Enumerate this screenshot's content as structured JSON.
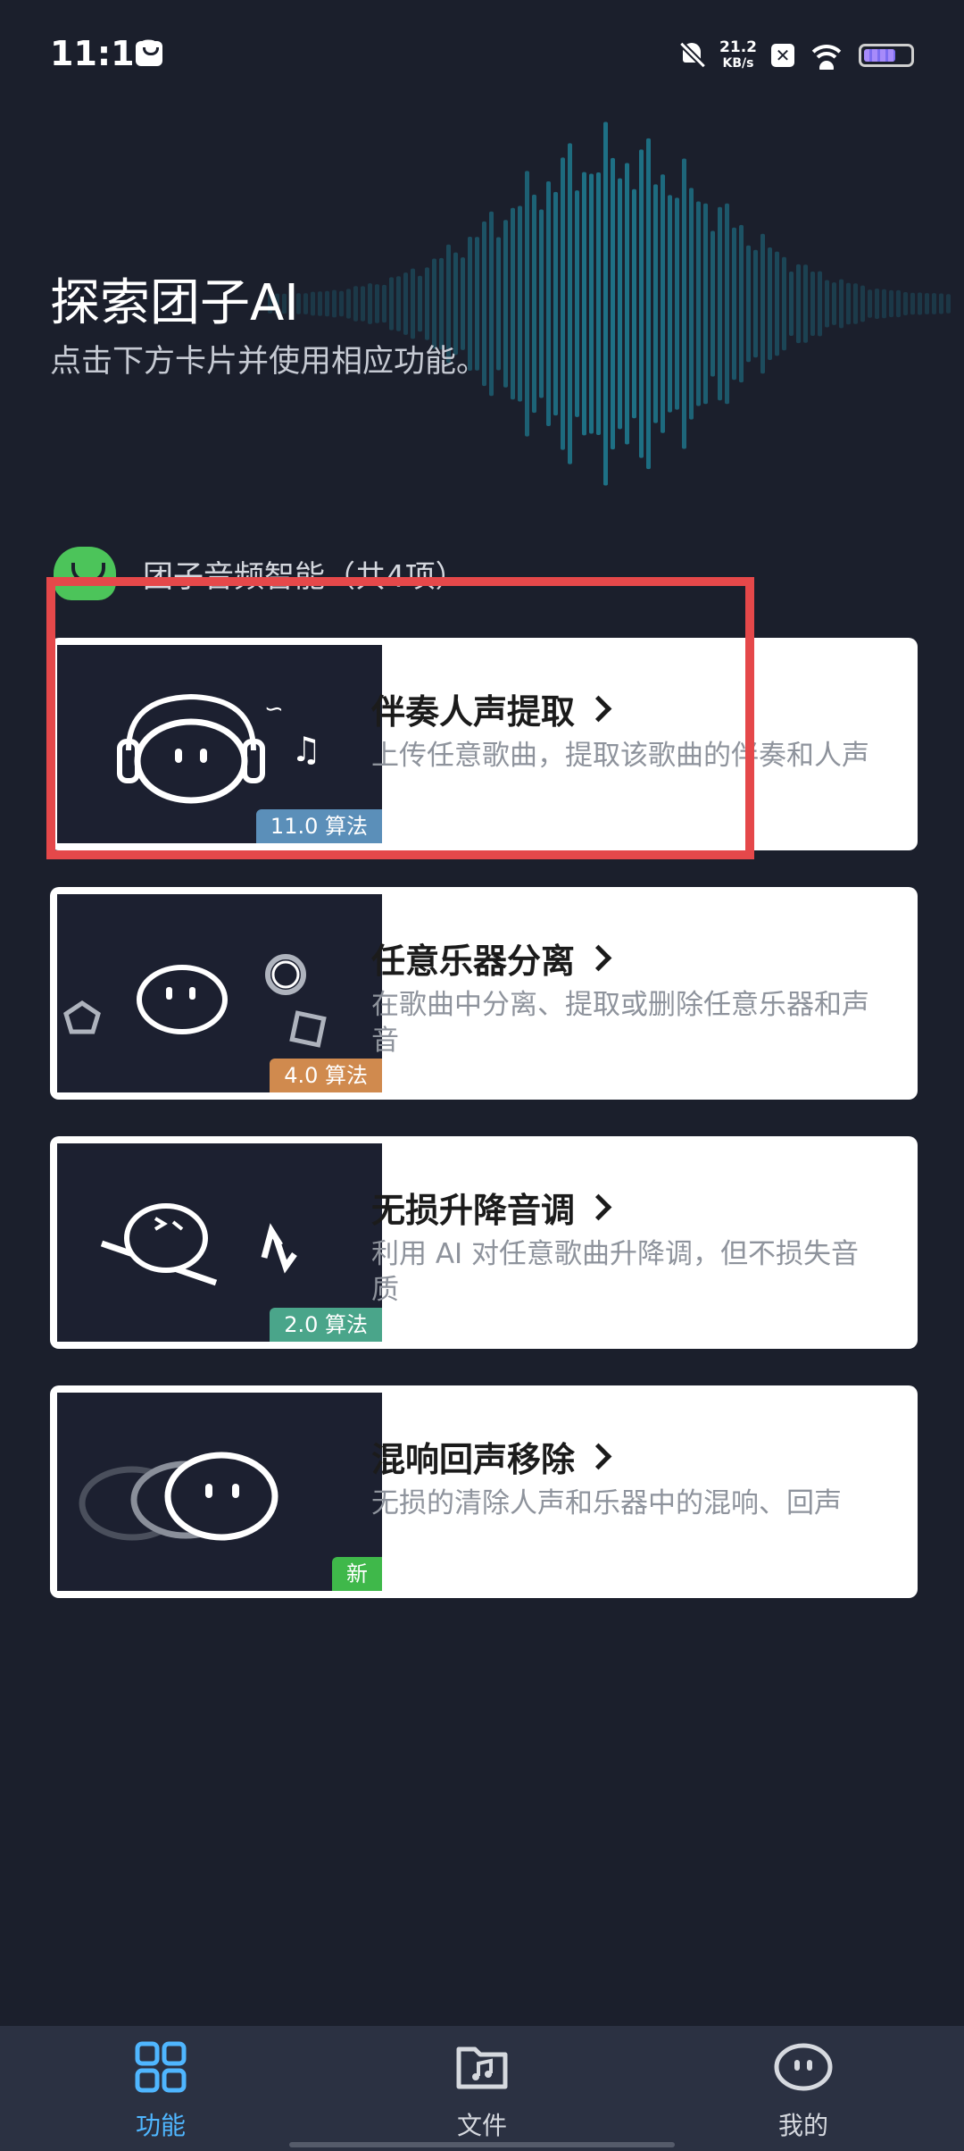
{
  "status_bar": {
    "time": "11:16",
    "net_speed_value": "21.2",
    "net_speed_unit": "KB/s",
    "battery_level": 0.7
  },
  "hero": {
    "title": "探索团子AI",
    "subtitle": "点击下方卡片并使用相应功能。"
  },
  "section": {
    "title": "团子音频智能（共4项）"
  },
  "cards": [
    {
      "title": "伴奏人声提取",
      "description": "上传任意歌曲，提取该歌曲的伴奏和人声",
      "badge": "11.0 算法",
      "badge_color": "#5b8fb9"
    },
    {
      "title": "任意乐器分离",
      "description": "在歌曲中分离、提取或删除任意乐器和声音",
      "badge": "4.0 算法",
      "badge_color": "#d08a4e"
    },
    {
      "title": "无损升降音调",
      "description": "利用 AI 对任意歌曲升降调，但不损失音质",
      "badge": "2.0 算法",
      "badge_color": "#4aa58a"
    },
    {
      "title": "混响回声移除",
      "description": "无损的清除人声和乐器中的混响、回声",
      "badge": "新",
      "badge_color": "#3fb84a"
    }
  ],
  "bottom_nav": {
    "tabs": [
      {
        "label": "功能",
        "icon": "grid-icon",
        "active": true
      },
      {
        "label": "文件",
        "icon": "music-folder-icon",
        "active": false
      },
      {
        "label": "我的",
        "icon": "mascot-face-icon",
        "active": false
      }
    ]
  },
  "colors": {
    "background": "#1b1f2c",
    "accent": "#4fb6ff",
    "highlight": "#e5484a",
    "nav": "#2b3142"
  }
}
